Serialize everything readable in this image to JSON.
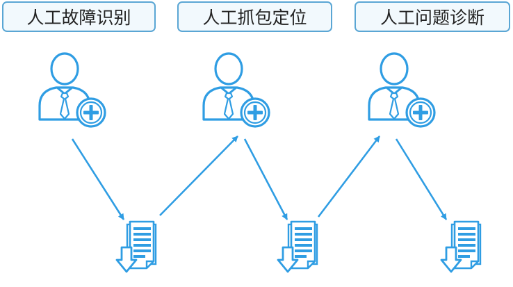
{
  "stages": [
    {
      "label": "人工故障识别",
      "icon": "engineer-add-icon"
    },
    {
      "label": "人工抓包定位",
      "icon": "engineer-add-icon"
    },
    {
      "label": "人工问题诊断",
      "icon": "engineer-add-icon"
    }
  ],
  "outputs": [
    {
      "icon": "document-download-icon"
    },
    {
      "icon": "document-download-icon"
    },
    {
      "icon": "document-download-icon"
    }
  ],
  "colors": {
    "stroke": "#2f9de3",
    "label_border": "#5aa6d4",
    "label_fill": "#f2f9fd",
    "icon_fill": "#ffffff",
    "text": "#222222"
  }
}
